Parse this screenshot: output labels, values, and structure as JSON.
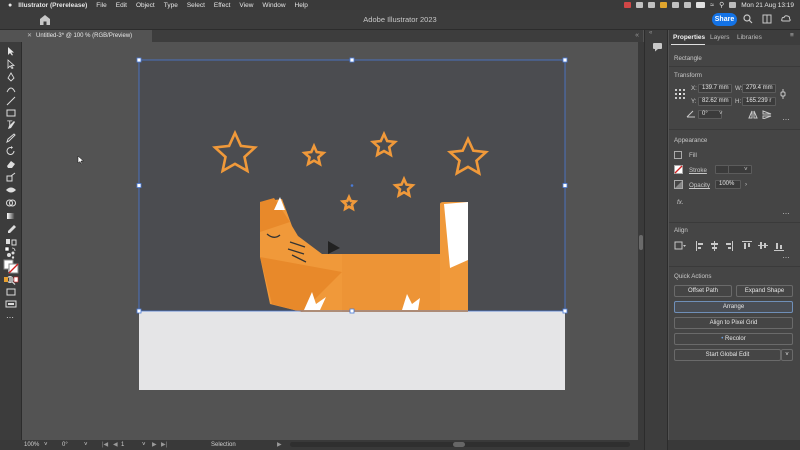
{
  "menubar": {
    "app": "Illustrator (Prerelease)",
    "items": [
      "File",
      "Edit",
      "Object",
      "Type",
      "Select",
      "Effect",
      "View",
      "Window",
      "Help"
    ],
    "datetime": "Mon 21 Aug  13:19"
  },
  "titlebar": {
    "title": "Adobe Illustrator 2023",
    "share_label": "Share"
  },
  "document": {
    "tab_title": "Untitled-3* @ 100 % (RGB/Preview)"
  },
  "status": {
    "zoom": "100%",
    "rotation": "0°",
    "artboard": "1",
    "tool": "Selection"
  },
  "panel": {
    "tabs": [
      "Properties",
      "Layers",
      "Libraries"
    ],
    "selection_type": "Rectangle",
    "transform": {
      "heading": "Transform",
      "x_label": "X:",
      "x": "139.7 mm",
      "y_label": "Y:",
      "y": "82.62 mm",
      "w_label": "W:",
      "w": "279.4 mm",
      "h_label": "H:",
      "h": "165.239 r",
      "angle": "0°"
    },
    "appearance": {
      "heading": "Appearance",
      "fill_label": "Fill",
      "stroke_label": "Stroke",
      "opacity_label": "Opacity",
      "opacity": "100%",
      "fx_label": "fx."
    },
    "align": {
      "heading": "Align"
    },
    "quick_actions": {
      "heading": "Quick Actions",
      "offset_path": "Offset Path",
      "expand_shape": "Expand Shape",
      "arrange": "Arrange",
      "align_pixel_grid": "Align to Pixel Grid",
      "recolor": "Recolor",
      "global_edit": "Start Global Edit"
    }
  },
  "colors": {
    "accent": "#1473e6",
    "fox_orange": "#f0993a",
    "artboard_dark": "#4b4c50",
    "artboard_light": "#e5e5e7",
    "selection": "#4a7bd8"
  }
}
